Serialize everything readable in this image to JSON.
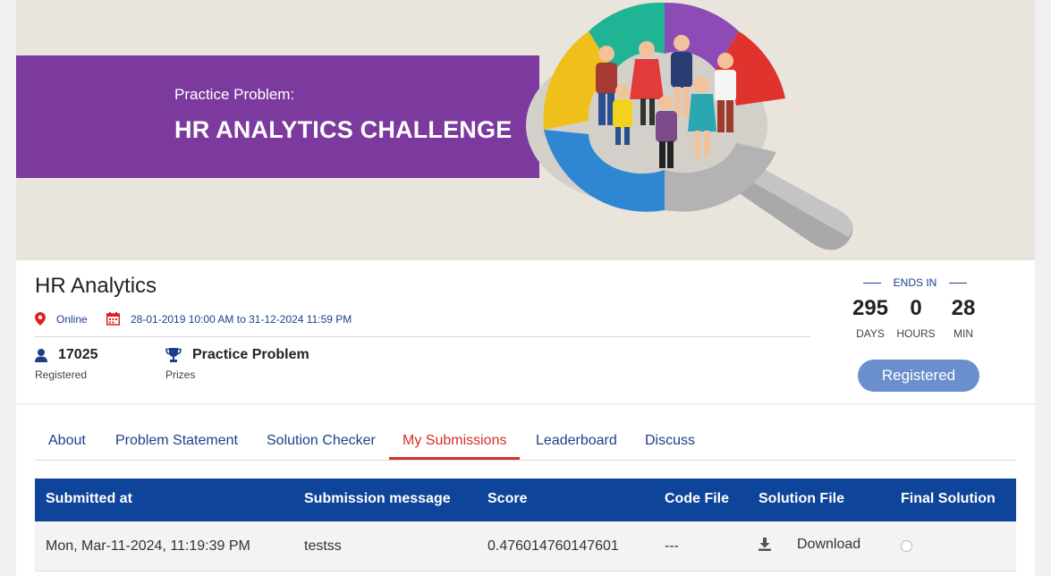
{
  "banner": {
    "subtitle": "Practice Problem:",
    "title": "HR ANALYTICS CHALLENGE"
  },
  "hackathon": {
    "name": "HR Analytics",
    "location": "Online",
    "dates": "28-01-2019 10:00 AM to 31-12-2024 11:59 PM",
    "registered_count": "17025",
    "registered_label": "Registered",
    "prize_value": "Practice Problem",
    "prize_label": "Prizes"
  },
  "countdown": {
    "heading": "ENDS IN",
    "days": "295",
    "days_label": "DAYS",
    "hours": "0",
    "hours_label": "HOURS",
    "min": "28",
    "min_label": "MIN"
  },
  "register_button": "Registered",
  "tabs": [
    {
      "label": "About"
    },
    {
      "label": "Problem Statement"
    },
    {
      "label": "Solution Checker"
    },
    {
      "label": "My Submissions",
      "active": true
    },
    {
      "label": "Leaderboard"
    },
    {
      "label": "Discuss"
    }
  ],
  "table": {
    "headers": [
      "Submitted at",
      "Submission message",
      "Score",
      "Code File",
      "Solution File",
      "Final Solution"
    ],
    "rows": [
      {
        "submitted_at": "Mon, Mar-11-2024, 11:19:39 PM",
        "message": "testss",
        "score": "0.476014760147601",
        "code_file": "---",
        "solution_file": "Download"
      }
    ]
  },
  "colors": {
    "banner_band": "#7c3a9e",
    "header_blue": "#0e4499",
    "link_blue": "#1d3f8a",
    "active_tab_red": "#d62f26",
    "button_blue": "#6a8fcc"
  },
  "icons": [
    "map-pin-icon",
    "calendar-icon",
    "user-icon",
    "trophy-icon",
    "download-icon"
  ]
}
